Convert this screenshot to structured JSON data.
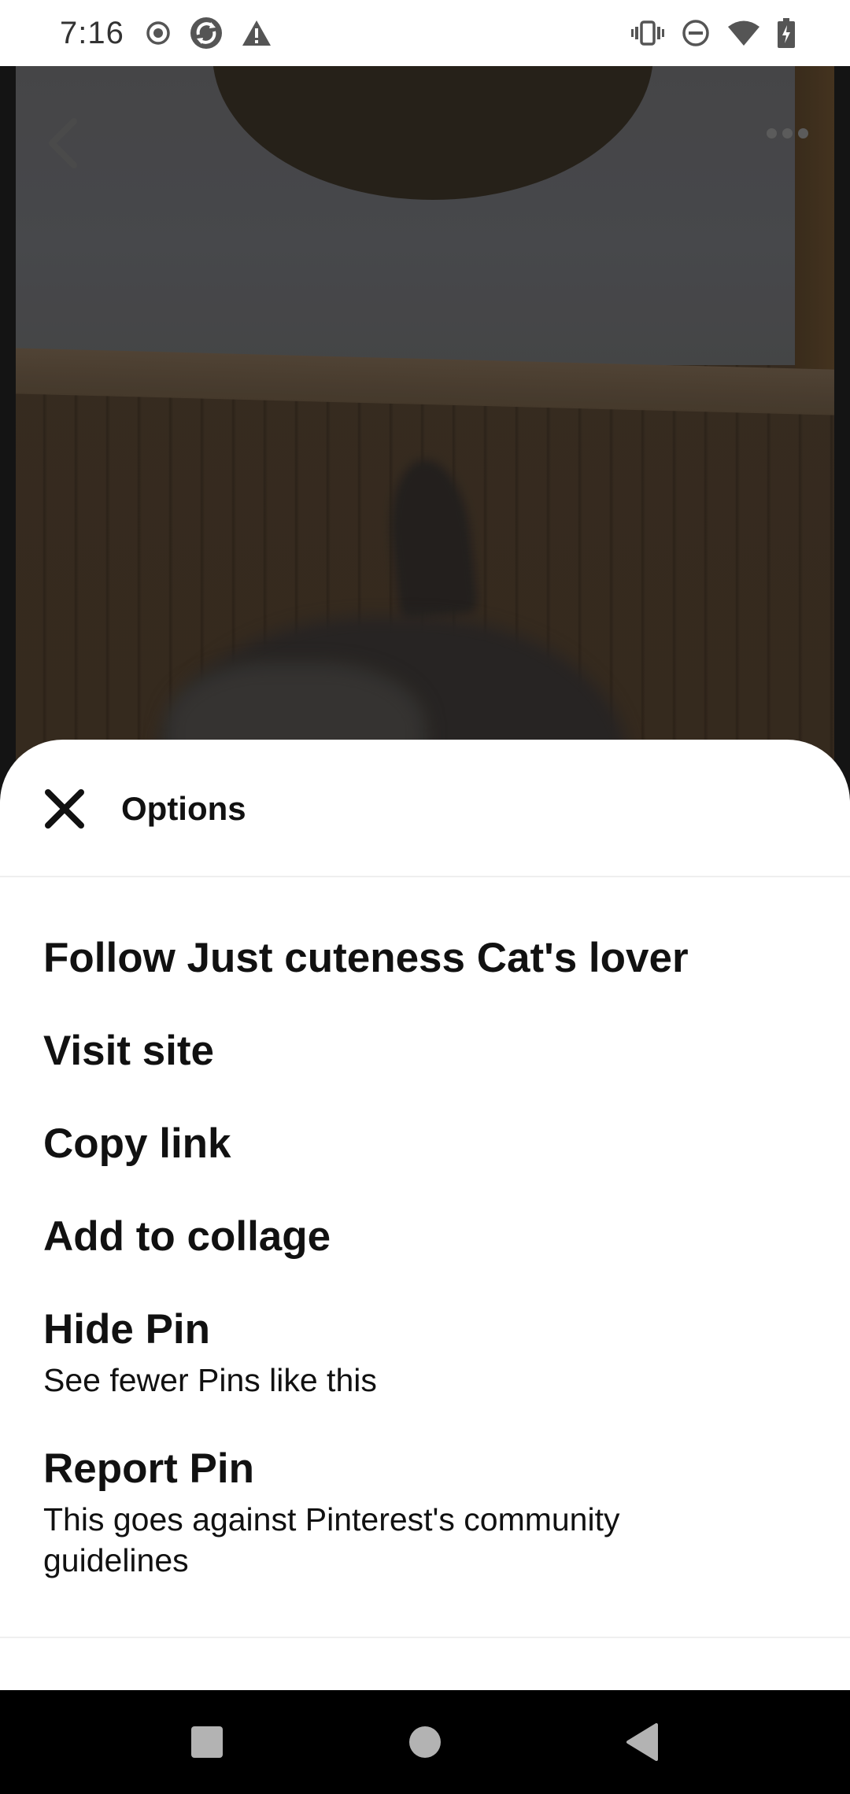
{
  "status_bar": {
    "time": "7:16",
    "left_icons": [
      "record-icon",
      "sync-app-icon",
      "warning-icon"
    ],
    "right_icons": [
      "vibrate-icon",
      "do-not-disturb-icon",
      "wifi-icon",
      "battery-charging-icon"
    ]
  },
  "pin": {
    "top_controls": [
      "back-arrow-icon",
      "more-options-icon"
    ]
  },
  "sheet": {
    "title": "Options",
    "close_icon": "close-icon",
    "options": [
      {
        "label": "Follow Just cuteness Cat's lover"
      },
      {
        "label": "Visit site"
      },
      {
        "label": "Copy link"
      },
      {
        "label": "Add to collage"
      },
      {
        "label": "Hide Pin",
        "subtitle": "See fewer Pins like this"
      },
      {
        "label": "Report Pin",
        "subtitle": "This goes against Pinterest's community guidelines"
      }
    ]
  },
  "nav_bar": {
    "buttons": [
      "recents-square-icon",
      "home-circle-icon",
      "back-triangle-icon"
    ]
  },
  "colors": {
    "sheet_background": "#ffffff",
    "text": "#111111",
    "divider": "#efefef",
    "nav_background": "#000000"
  }
}
